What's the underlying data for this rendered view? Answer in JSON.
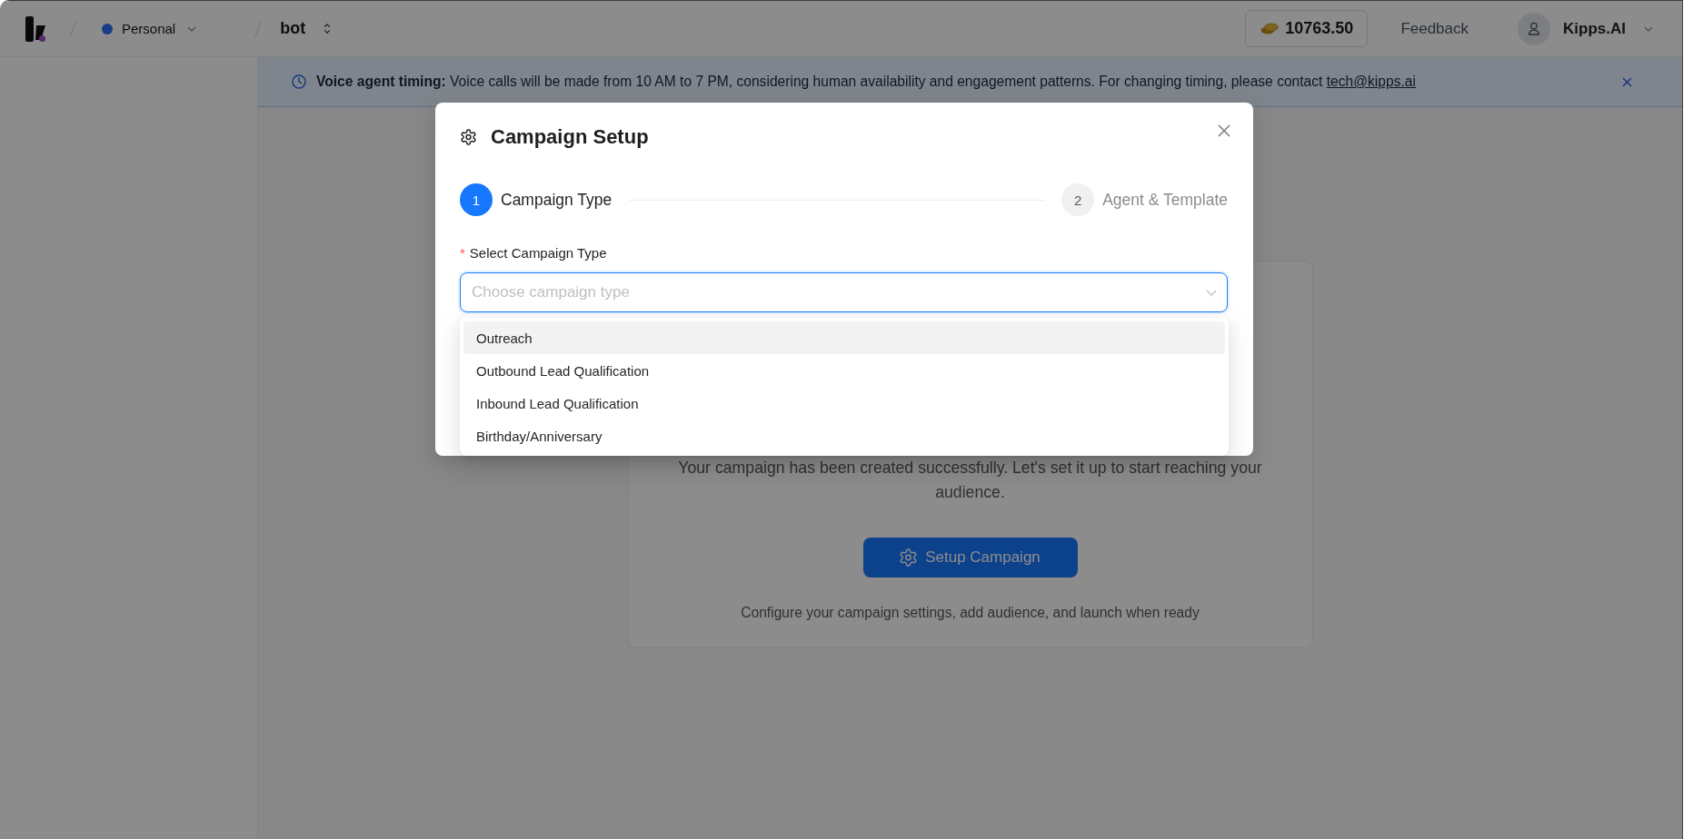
{
  "top_bar": {
    "workspace": "Personal",
    "project": "bot",
    "credits": "10763.50",
    "feedback": "Feedback",
    "account": "Kipps.AI"
  },
  "banner": {
    "message": "**Voice agent timing:** Voice calls will be made from 10 AM to 7 PM, considering human availability and engagement patterns. For changing timing, please contact",
    "link": "tech@kipps.ai"
  },
  "card": {
    "message": "Your campaign has been created successfully. Let's set it up to start reaching your audience.",
    "button": "Setup Campaign",
    "hint": "Configure your campaign settings, add audience, and launch when ready"
  },
  "modal": {
    "title": "Campaign Setup",
    "steps": [
      {
        "number": "1",
        "label": "Campaign Type",
        "current": true
      },
      {
        "number": "2",
        "label": "Agent & Template",
        "current": false
      }
    ],
    "field": {
      "required_mark": "*",
      "label": "Select Campaign Type",
      "placeholder": "Choose campaign type",
      "focused": true
    },
    "options": [
      {
        "label": "Outreach",
        "highlighted": true
      },
      {
        "label": "Outbound Lead Qualification",
        "highlighted": false
      },
      {
        "label": "Inbound Lead Qualification",
        "highlighted": false
      },
      {
        "label": "Birthday/Anniversary",
        "highlighted": false
      }
    ]
  }
}
